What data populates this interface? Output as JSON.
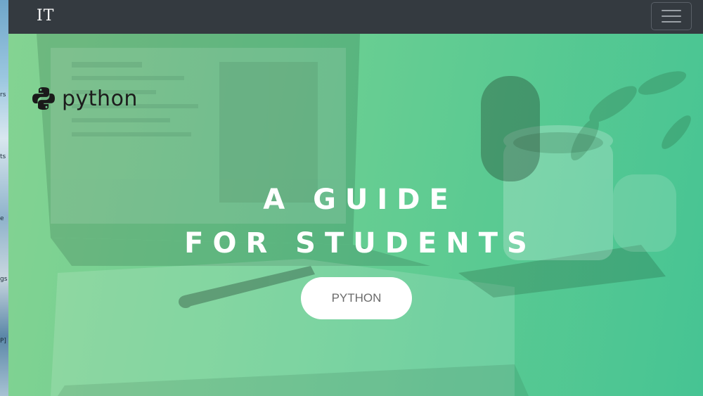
{
  "navbar": {
    "brand": "IT",
    "menu_icon": "hamburger-menu-icon"
  },
  "hero": {
    "logo_icon": "python-logo-icon",
    "logo_text": "python",
    "headline_line1": "A GUIDE",
    "headline_line2": "FOR STUDENTS",
    "cta_label": "PYTHON"
  },
  "desktop_fragments": [
    "rs",
    "ts",
    "e",
    "gs",
    "P]"
  ],
  "colors": {
    "navbar": "#343a40",
    "hero_overlay_start": "#7fd28e",
    "hero_overlay_end": "#3fc28f",
    "headline_text": "#ffffff",
    "cta_background": "#ffffff",
    "cta_text": "#6b6b6b"
  }
}
